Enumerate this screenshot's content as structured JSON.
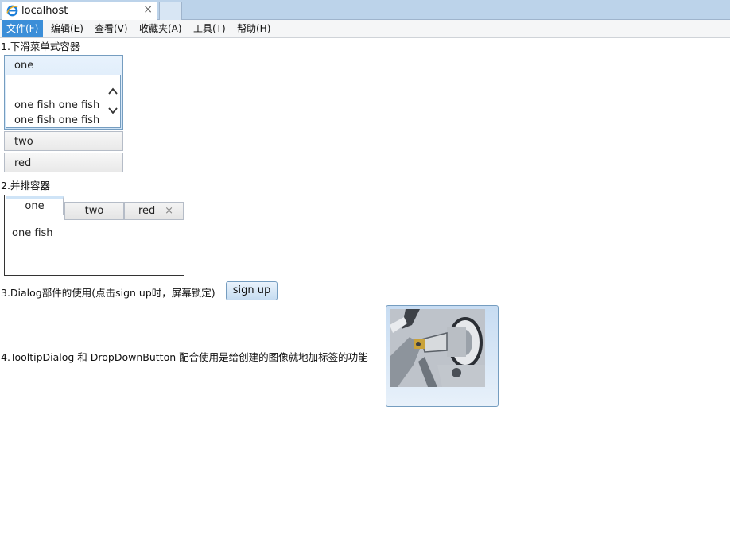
{
  "browser": {
    "tab_title": "localhost",
    "tab_close": "×"
  },
  "menubar": {
    "items": [
      "文件(F)",
      "编辑(E)",
      "查看(V)",
      "收藏夹(A)",
      "工具(T)",
      "帮助(H)"
    ],
    "active_index": 0
  },
  "sections": {
    "accordion_label": "1.下滑菜单式容器",
    "tabcontainer_label": "2.并排容器",
    "dialog_label": "3.Dialog部件的使用(点击sign up时，屏幕锁定)",
    "tooltip_label": "4.TooltipDialog 和 DropDownButton 配合使用是给创建的图像就地加标签的功能"
  },
  "accordion": {
    "panes": [
      "one",
      "two",
      "red"
    ],
    "selected": "one",
    "content_lines": [
      "one fish one fish",
      "one fish one fish"
    ]
  },
  "tabcontainer": {
    "tabs": [
      "one",
      "two",
      "red"
    ],
    "selected": "one",
    "close_glyph": "×",
    "content": "one fish"
  },
  "dialog_button": {
    "label": "sign up"
  },
  "colors": {
    "accent": "#3b8ed8",
    "pane_border": "#759dc0",
    "chrome": "#bcd3ea"
  },
  "icons": [
    "ie-logo-icon",
    "close-icon",
    "chevron-up-icon",
    "chevron-down-icon",
    "tab-close-icon"
  ]
}
